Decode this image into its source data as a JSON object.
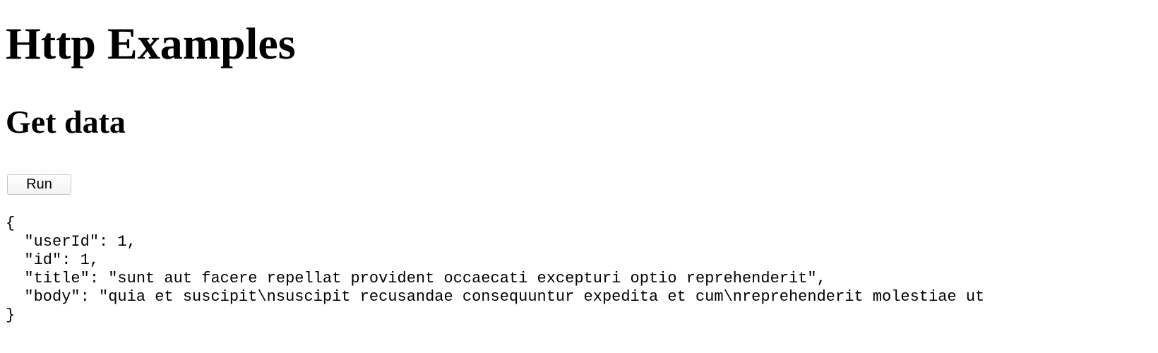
{
  "header": {
    "title": "Http Examples"
  },
  "section": {
    "title": "Get data",
    "run_label": "Run"
  },
  "output": {
    "lines": [
      "{",
      "  \"userId\": 1,",
      "  \"id\": 1,",
      "  \"title\": \"sunt aut facere repellat provident occaecati excepturi optio reprehenderit\",",
      "  \"body\": \"quia et suscipit\\nsuscipit recusandae consequuntur expedita et cum\\nreprehenderit molestiae ut",
      "}"
    ]
  }
}
